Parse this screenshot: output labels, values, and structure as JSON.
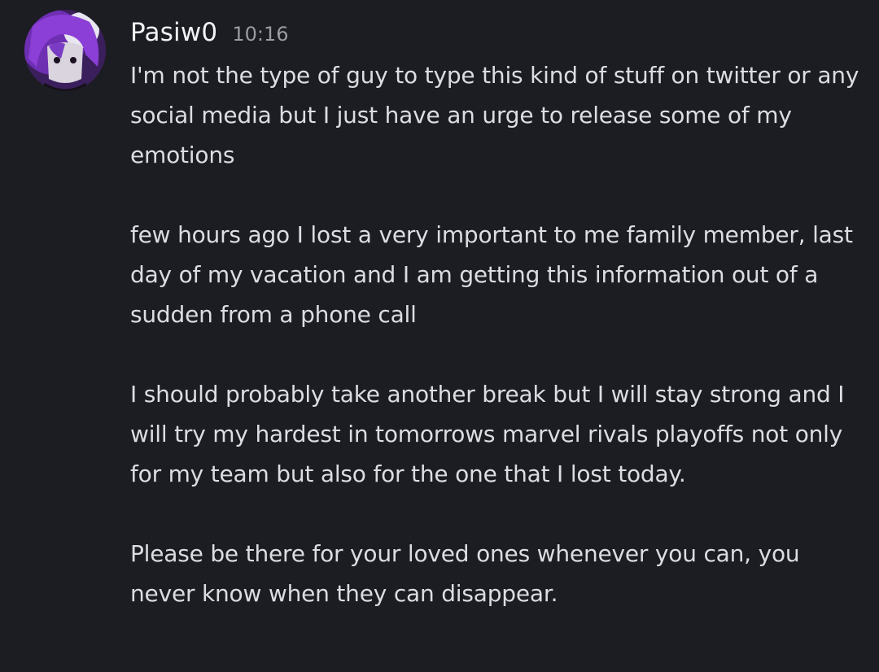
{
  "message": {
    "author": "Pasiw0",
    "timestamp": "10:16",
    "avatar_icon": "user-avatar",
    "paragraphs": [
      "I'm not the type of guy to type this kind of stuff on twitter or any social media but I just have an urge to release some of my emotions",
      "few hours ago I lost a very important to me family member, last day of my vacation and I am getting this information out of a sudden from a phone call",
      "I should probably take another break but I will stay strong and I will try my hardest in tomorrows marvel rivals playoffs not only for my team but also for the one that I lost today.",
      "Please be there for your loved ones whenever you can, you never know when they can disappear."
    ]
  },
  "colors": {
    "background": "#1c1d22",
    "username": "#f2f3f5",
    "timestamp": "#9a9ca3",
    "text": "#dcdde1"
  }
}
